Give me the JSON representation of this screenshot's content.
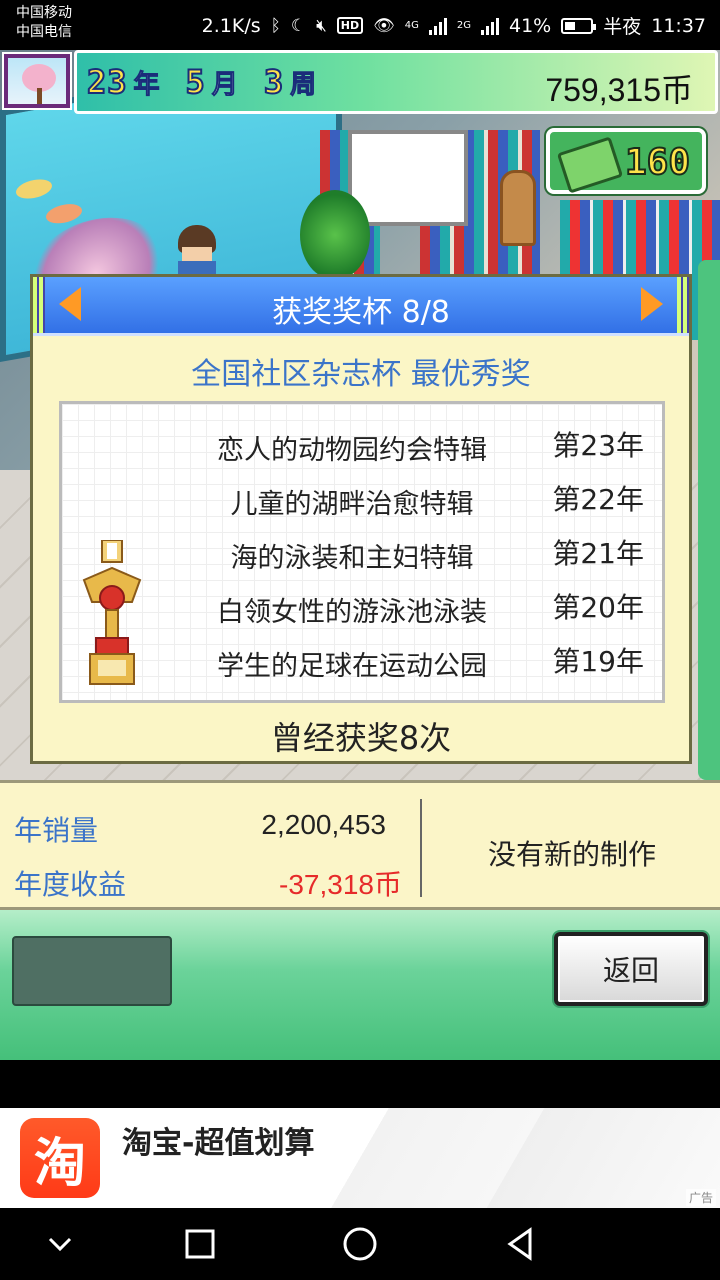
{
  "status_bar": {
    "carrier_1": "中国移动",
    "carrier_2": "中国电信",
    "net_speed": "2.1K/s",
    "hd_badge": "HD",
    "net_4g": "4G",
    "net_2g": "2G",
    "battery": "41%",
    "time_period": "半夜",
    "time": "11:37"
  },
  "hud": {
    "year_num": "23",
    "year_unit": "年",
    "month_num": "5",
    "month_unit": "月",
    "week_num": "3",
    "week_unit": "周",
    "money": "759,315币",
    "cash_count": "160"
  },
  "dialog": {
    "title": "获奖奖杯 8/8",
    "award_name": "全国社区杂志杯 最优秀奖",
    "entries": [
      {
        "title": "恋人的动物园约会特辑",
        "year": "第23年"
      },
      {
        "title": "儿童的湖畔治愈特辑",
        "year": "第22年"
      },
      {
        "title": "海的泳装和主妇特辑",
        "year": "第21年"
      },
      {
        "title": "白领女性的游泳池泳装",
        "year": "第20年"
      },
      {
        "title": "学生的足球在运动公园",
        "year": "第19年"
      }
    ],
    "win_count": "曾经获奖8次"
  },
  "stats": {
    "annual_sales_label": "年销量",
    "annual_sales_value": "2,200,453",
    "annual_profit_label": "年度收益",
    "annual_profit_value": "-37,318币",
    "note": "没有新的制作"
  },
  "actions": {
    "back_label": "返回"
  },
  "ad": {
    "logo_char": "淘",
    "title": "淘宝-超值划算",
    "tag": "广告"
  },
  "colors": {
    "accent_blue": "#3b74c9",
    "negative_red": "#e62a2a",
    "dialog_header": "#3270e6",
    "gold": "#ffe34a"
  }
}
